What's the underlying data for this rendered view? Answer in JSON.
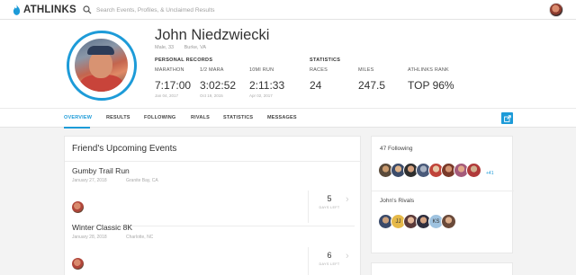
{
  "header": {
    "logo_text": "ATHLINKS",
    "search_placeholder": "Search Events, Profiles, & Unclaimed Results"
  },
  "profile": {
    "name": "John Niedzwiecki",
    "gender_age": "Male, 33",
    "location": "Burke, VA",
    "personal_records_label": "PERSONAL RECORDS",
    "statistics_label": "STATISTICS",
    "records": [
      {
        "label": "MARATHON",
        "value": "7:17:00",
        "date": "Jan 04, 2017"
      },
      {
        "label": "1/2 MARA",
        "value": "3:02:52",
        "date": "Oct 19, 2015"
      },
      {
        "label": "10MI RUN",
        "value": "2:11:33",
        "date": "Apr 02, 2017"
      }
    ],
    "stats": [
      {
        "label": "RACES",
        "value": "24"
      },
      {
        "label": "MILES",
        "value": "247.5"
      },
      {
        "label": "ATHLINKS RANK",
        "value": "TOP 96%"
      }
    ]
  },
  "tabs": [
    {
      "label": "OVERVIEW",
      "active": true
    },
    {
      "label": "RESULTS"
    },
    {
      "label": "FOLLOWING"
    },
    {
      "label": "RIVALS"
    },
    {
      "label": "STATISTICS"
    },
    {
      "label": "MESSAGES"
    }
  ],
  "upcoming": {
    "title": "Friend's Upcoming Events",
    "events": [
      {
        "name": "Gumby Trail Run",
        "date": "January 27, 2018",
        "location": "Granite Bay, CA",
        "days": "5",
        "days_label": "DAYS LEFT"
      },
      {
        "name": "Winter Classic 8K",
        "date": "January 28, 2018",
        "location": "Charlotte, NC",
        "days": "6",
        "days_label": "DAYS LEFT"
      }
    ]
  },
  "following": {
    "title": "47 Following",
    "more": "+41"
  },
  "rivals": {
    "title": "John's Rivals",
    "initials": [
      "JJ",
      "KS"
    ]
  },
  "colors": {
    "accent": "#1d9bd8"
  }
}
